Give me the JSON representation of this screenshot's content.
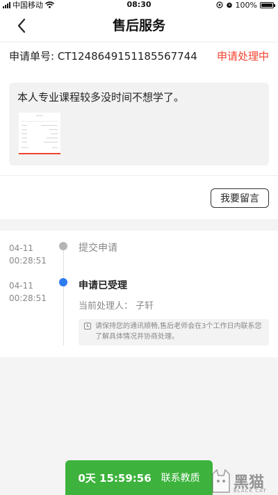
{
  "status_bar": {
    "carrier": "中国移动",
    "time": "08:30",
    "battery": "100%"
  },
  "header": {
    "title": "售后服务"
  },
  "order": {
    "label": "申请单号: CT1248649151185567744",
    "status": "申请处理中"
  },
  "reason": {
    "text": "本人专业课程较多没时间不想学了。"
  },
  "message_button": {
    "label": "我要留言"
  },
  "timeline": [
    {
      "date": "04-11",
      "time": "00:28:51",
      "title": "提交申请"
    },
    {
      "date": "04-11",
      "time": "00:28:51",
      "title": "申请已受理",
      "handler": "当前处理人： 子轩",
      "note": "请保持您的通讯顺畅,售后老师会在3个工作日内联系您了解具体情况并协商处理。"
    }
  ],
  "contact": {
    "countdown": "0天 15:59:56",
    "label": "联系教质"
  },
  "colors": {
    "accent_red": "#f2422f",
    "active_blue": "#2f7bf0",
    "inactive_gray": "#b5b5b5",
    "contact_green": "#3db33d"
  },
  "watermark": {
    "text": "黑猫",
    "sub": "BLACK CAT"
  }
}
